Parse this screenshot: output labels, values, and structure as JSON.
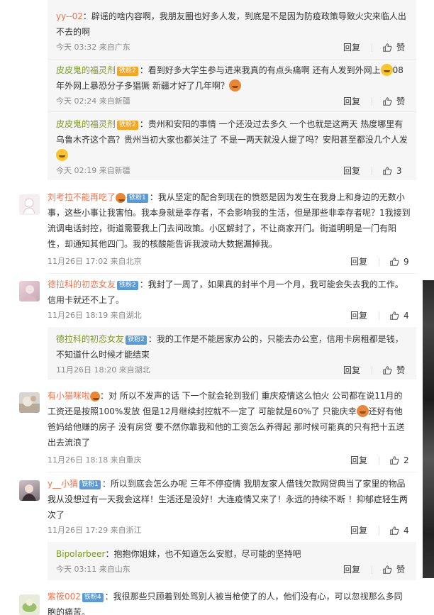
{
  "labels": {
    "reply": "回复",
    "zan": "赞"
  },
  "replies_top": [
    {
      "user": "yy--02",
      "badge": "",
      "text": "：辟谣的啥内容啊，我朋友圈也好多人发，到底是不是因为防疫政策导致火灾来临人出不去的啊",
      "time": "今天 03:32 来自广东",
      "likes": "赞"
    },
    {
      "user": "皮皮鬼的福灵剂",
      "badge": "铁粉2",
      "text_a": "：看到好多大学生参与进来我真的有点头痛啊 还有人发到外网上",
      "text_b": "08年外网上暴恐分子多猖獗 新疆才好了几年啊？",
      "emoji1": "smile-emoji",
      "emoji2": "scared-emoji",
      "time": "今天 02:24 来自新疆",
      "likes": "赞"
    },
    {
      "user": "皮皮鬼的福灵剂",
      "badge": "铁粉2",
      "text": "：贵州和安阳的事情 一个还没过去多久 一个也就是这两天 热度哪里有乌鲁木齐这个高？贵州当初大家也都关注了 不是一两天就没人提了吗？安阳甚至都没几个人发",
      "emoji": "surprised-emoji",
      "time": "今天 02:19 来自新疆",
      "likes": "3"
    }
  ],
  "comments": [
    {
      "user": "刘考拉不能再吃了",
      "badge": "铁粉1",
      "text": "：我从坚定的配合到现在的愤怒是因为发生在我身上和身边的无数小事，这些小事让我害怕。我本身就是幸存者，不会影响我的生活，但是那些非幸存者呢？1我接到流调电话封控，街道需要我上门去问政策。小区解封了，不让商家开门。街道明明是一门有阳性，却通知其他四门。我的核酸能告诉我波动大数据漏掉我。",
      "time": "11月26日 17:02 来自北京",
      "likes": "9"
    },
    {
      "user": "德拉科的初恋女友",
      "badge": "铁粉2",
      "text": "：我封了一周了，如果真的封半个月一个月，我可能会失去我的工作。信用卡就还不上了。",
      "time": "11月26日 18:19 来自湖北",
      "likes": "4",
      "reply": {
        "user": "德拉科的初恋女友",
        "badge": "铁粉2",
        "text": "：我的工作是不能居家办公的，只能去办公室，信用卡房租都是钱，不知道什么时候才能结束",
        "time": "11月26日 18:20 来自湖北",
        "likes": "赞"
      }
    },
    {
      "user": "有小猫咪啦",
      "badge": "",
      "text_a": "：对 所以不发声的话 下一个就会轮到我们 重庆疫情这么怕火 公司都在说11月的工资还是按照100%发放 但是12月继续封控就不一定了 可能就是60%了 只能庆幸",
      "text_b": "还好有他爸妈给他赚的房子 没有房贷 要不然你靠我和他的工资怎么养得起 那时候可能真的只有把十五送出去流浪了",
      "emoji": "tangerine-emoji",
      "time": "11月26日 18:18 来自重庆",
      "likes": "2"
    },
    {
      "user": "y__小猜",
      "badge": "铁粉1",
      "text": "：所以到底会怎么办呢 三年不停疫情 我朋友家人借钱欠款网贷典当了家里的物品 我从没想过有一天我会这样！生活还是没好！大连疫情又来了！永远的持续不断 ！抑郁症轻生两次了",
      "time": "11月26日 17:29 来自浙江",
      "likes": "4",
      "reply": {
        "user": "Bipolarbeer",
        "badge": "",
        "text": "：抱抱你姐妹，也不知道怎么安慰，尽可能的坚持吧",
        "time": "今天 03:11 来自山东",
        "likes": "赞"
      }
    },
    {
      "user": "紫筱002",
      "badge": "铁粉4",
      "text": "：我很那些只顾着到处骂别人被当枪使了的人，他们没有心，可以忽视那么多同胞的痛苦。",
      "time": "",
      "likes": ""
    }
  ]
}
